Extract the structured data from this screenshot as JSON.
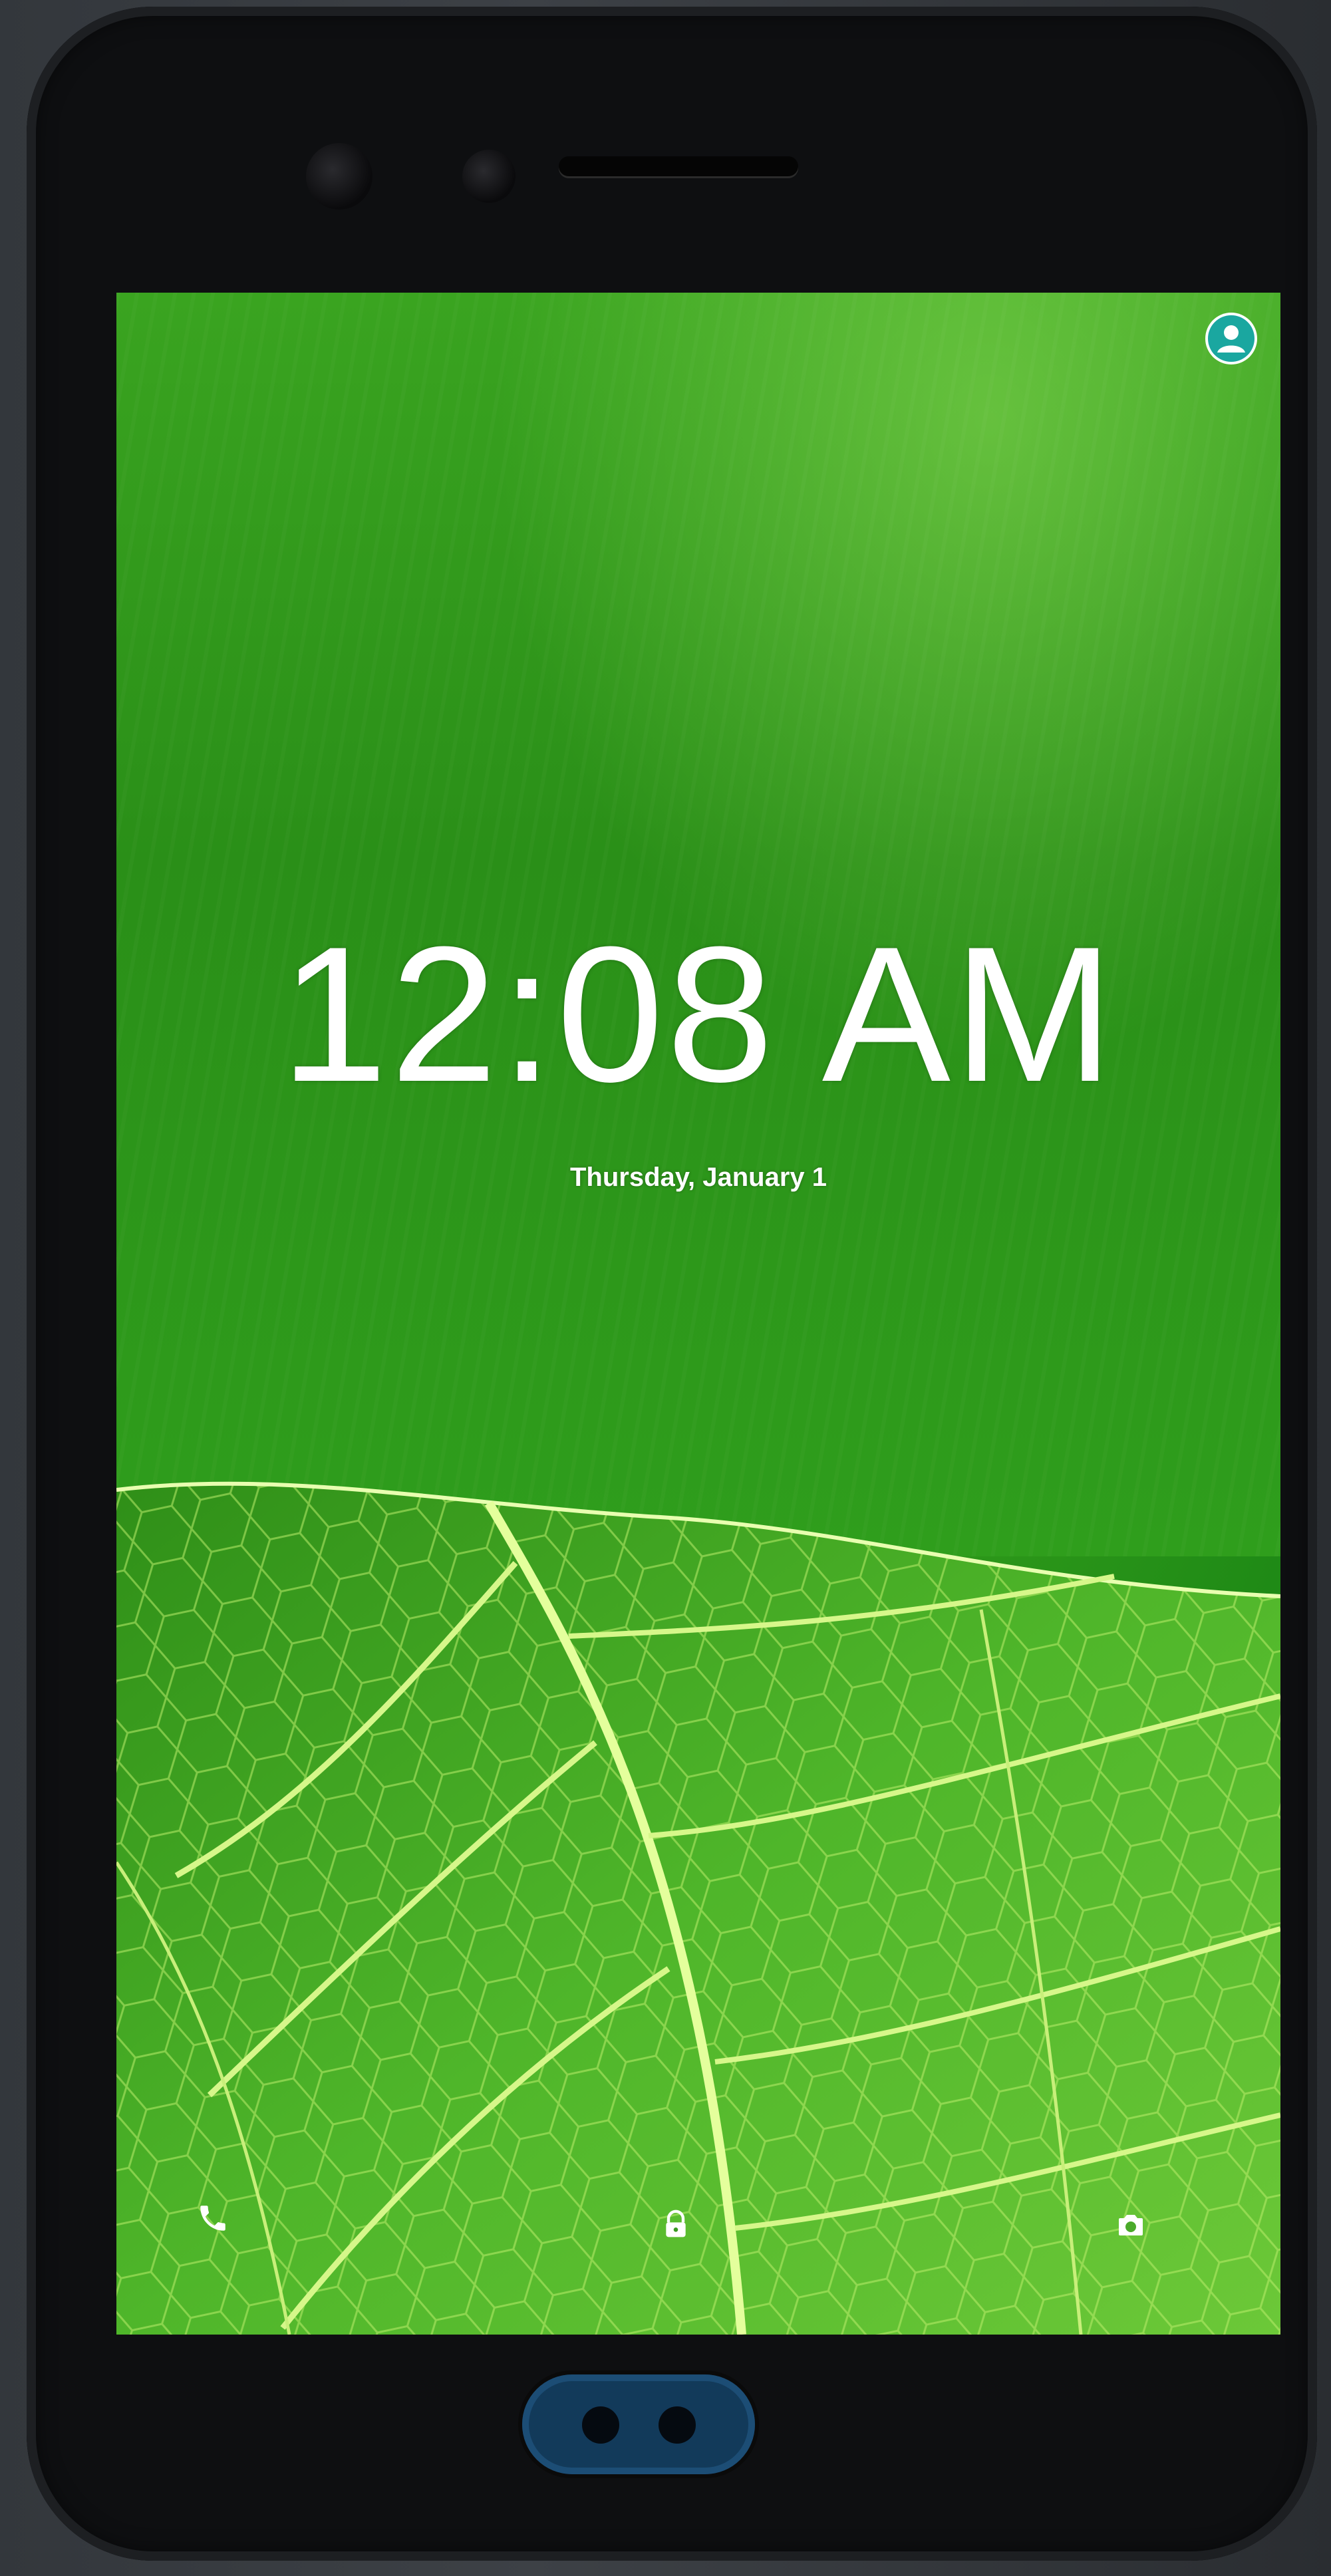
{
  "lockscreen": {
    "time": "12:08 AM",
    "date": "Thursday, January 1"
  },
  "icons": {
    "user": "user-account-icon",
    "phone": "phone-icon",
    "lock": "lock-icon",
    "camera": "camera-icon"
  },
  "colors": {
    "wallpaper_green": "#2f9a1a",
    "text": "#ffffff",
    "user_icon_fill": "#1aa7a0"
  }
}
